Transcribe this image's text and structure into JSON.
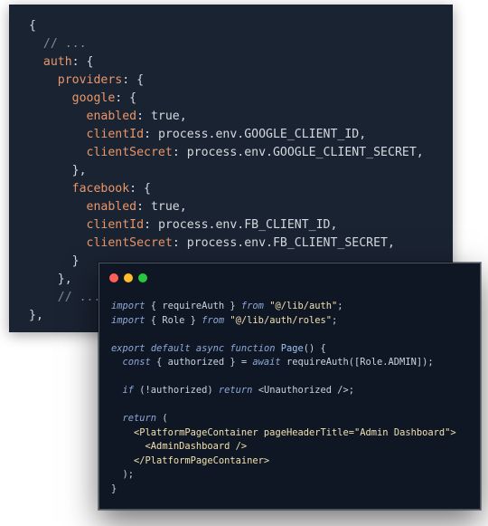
{
  "back_code": {
    "l1": "{",
    "l2": "  // ...",
    "l3a": "  ",
    "l3b": "auth",
    "l3c": ": {",
    "l4a": "    ",
    "l4b": "providers",
    "l4c": ": {",
    "l5a": "      ",
    "l5b": "google",
    "l5c": ": {",
    "l6a": "        ",
    "l6b": "enabled",
    "l6c": ": true,",
    "l7a": "        ",
    "l7b": "clientId",
    "l7c": ": process.env.GOOGLE_CLIENT_ID,",
    "l8a": "        ",
    "l8b": "clientSecret",
    "l8c": ": process.env.GOOGLE_CLIENT_SECRET,",
    "l9": "      },",
    "l10a": "      ",
    "l10b": "facebook",
    "l10c": ": {",
    "l11a": "        ",
    "l11b": "enabled",
    "l11c": ": true,",
    "l12a": "        ",
    "l12b": "clientId",
    "l12c": ": process.env.FB_CLIENT_ID,",
    "l13a": "        ",
    "l13b": "clientSecret",
    "l13c": ": process.env.FB_CLIENT_SECRET,",
    "l14": "      }",
    "l15": "    },",
    "l16": "    // ...",
    "l17": "},"
  },
  "front_code": {
    "import_kw": "import",
    "from_kw": "from",
    "i1_body": " { requireAuth } ",
    "i1_path": "\"@/lib/auth\"",
    "i2_body": " { Role } ",
    "i2_path": "\"@/lib/auth/roles\"",
    "semi": ";",
    "export_kw": "export",
    "default_kw": "default",
    "async_kw": "async",
    "function_kw": "function",
    "fn_name": "Page",
    "fn_sig": "() {",
    "const_kw": "const",
    "destructure": " { authorized } = ",
    "await_kw": "await",
    "call": " requireAuth([Role.ADMIN]);",
    "if_kw": "if",
    "cond": " (!authorized) ",
    "return_kw": "return",
    "unauth_tag": "<Unauthorized />",
    "return_open": " (",
    "container_open": "<PlatformPageContainer",
    "attr_name": " pageHeaderTitle=",
    "attr_val": "\"Admin Dashboard\"",
    "tag_close": ">",
    "admin_tag": "<AdminDashboard />",
    "container_close": "</PlatformPageContainer>",
    "paren_close": ");",
    "brace_close": "}"
  },
  "colors": {
    "back_bg": "#1a2332",
    "front_bg": "#0f1724",
    "key": "#e8966a",
    "comment": "#7f8a99",
    "keyword": "#8fa8d8",
    "string": "#f1e0b0"
  }
}
